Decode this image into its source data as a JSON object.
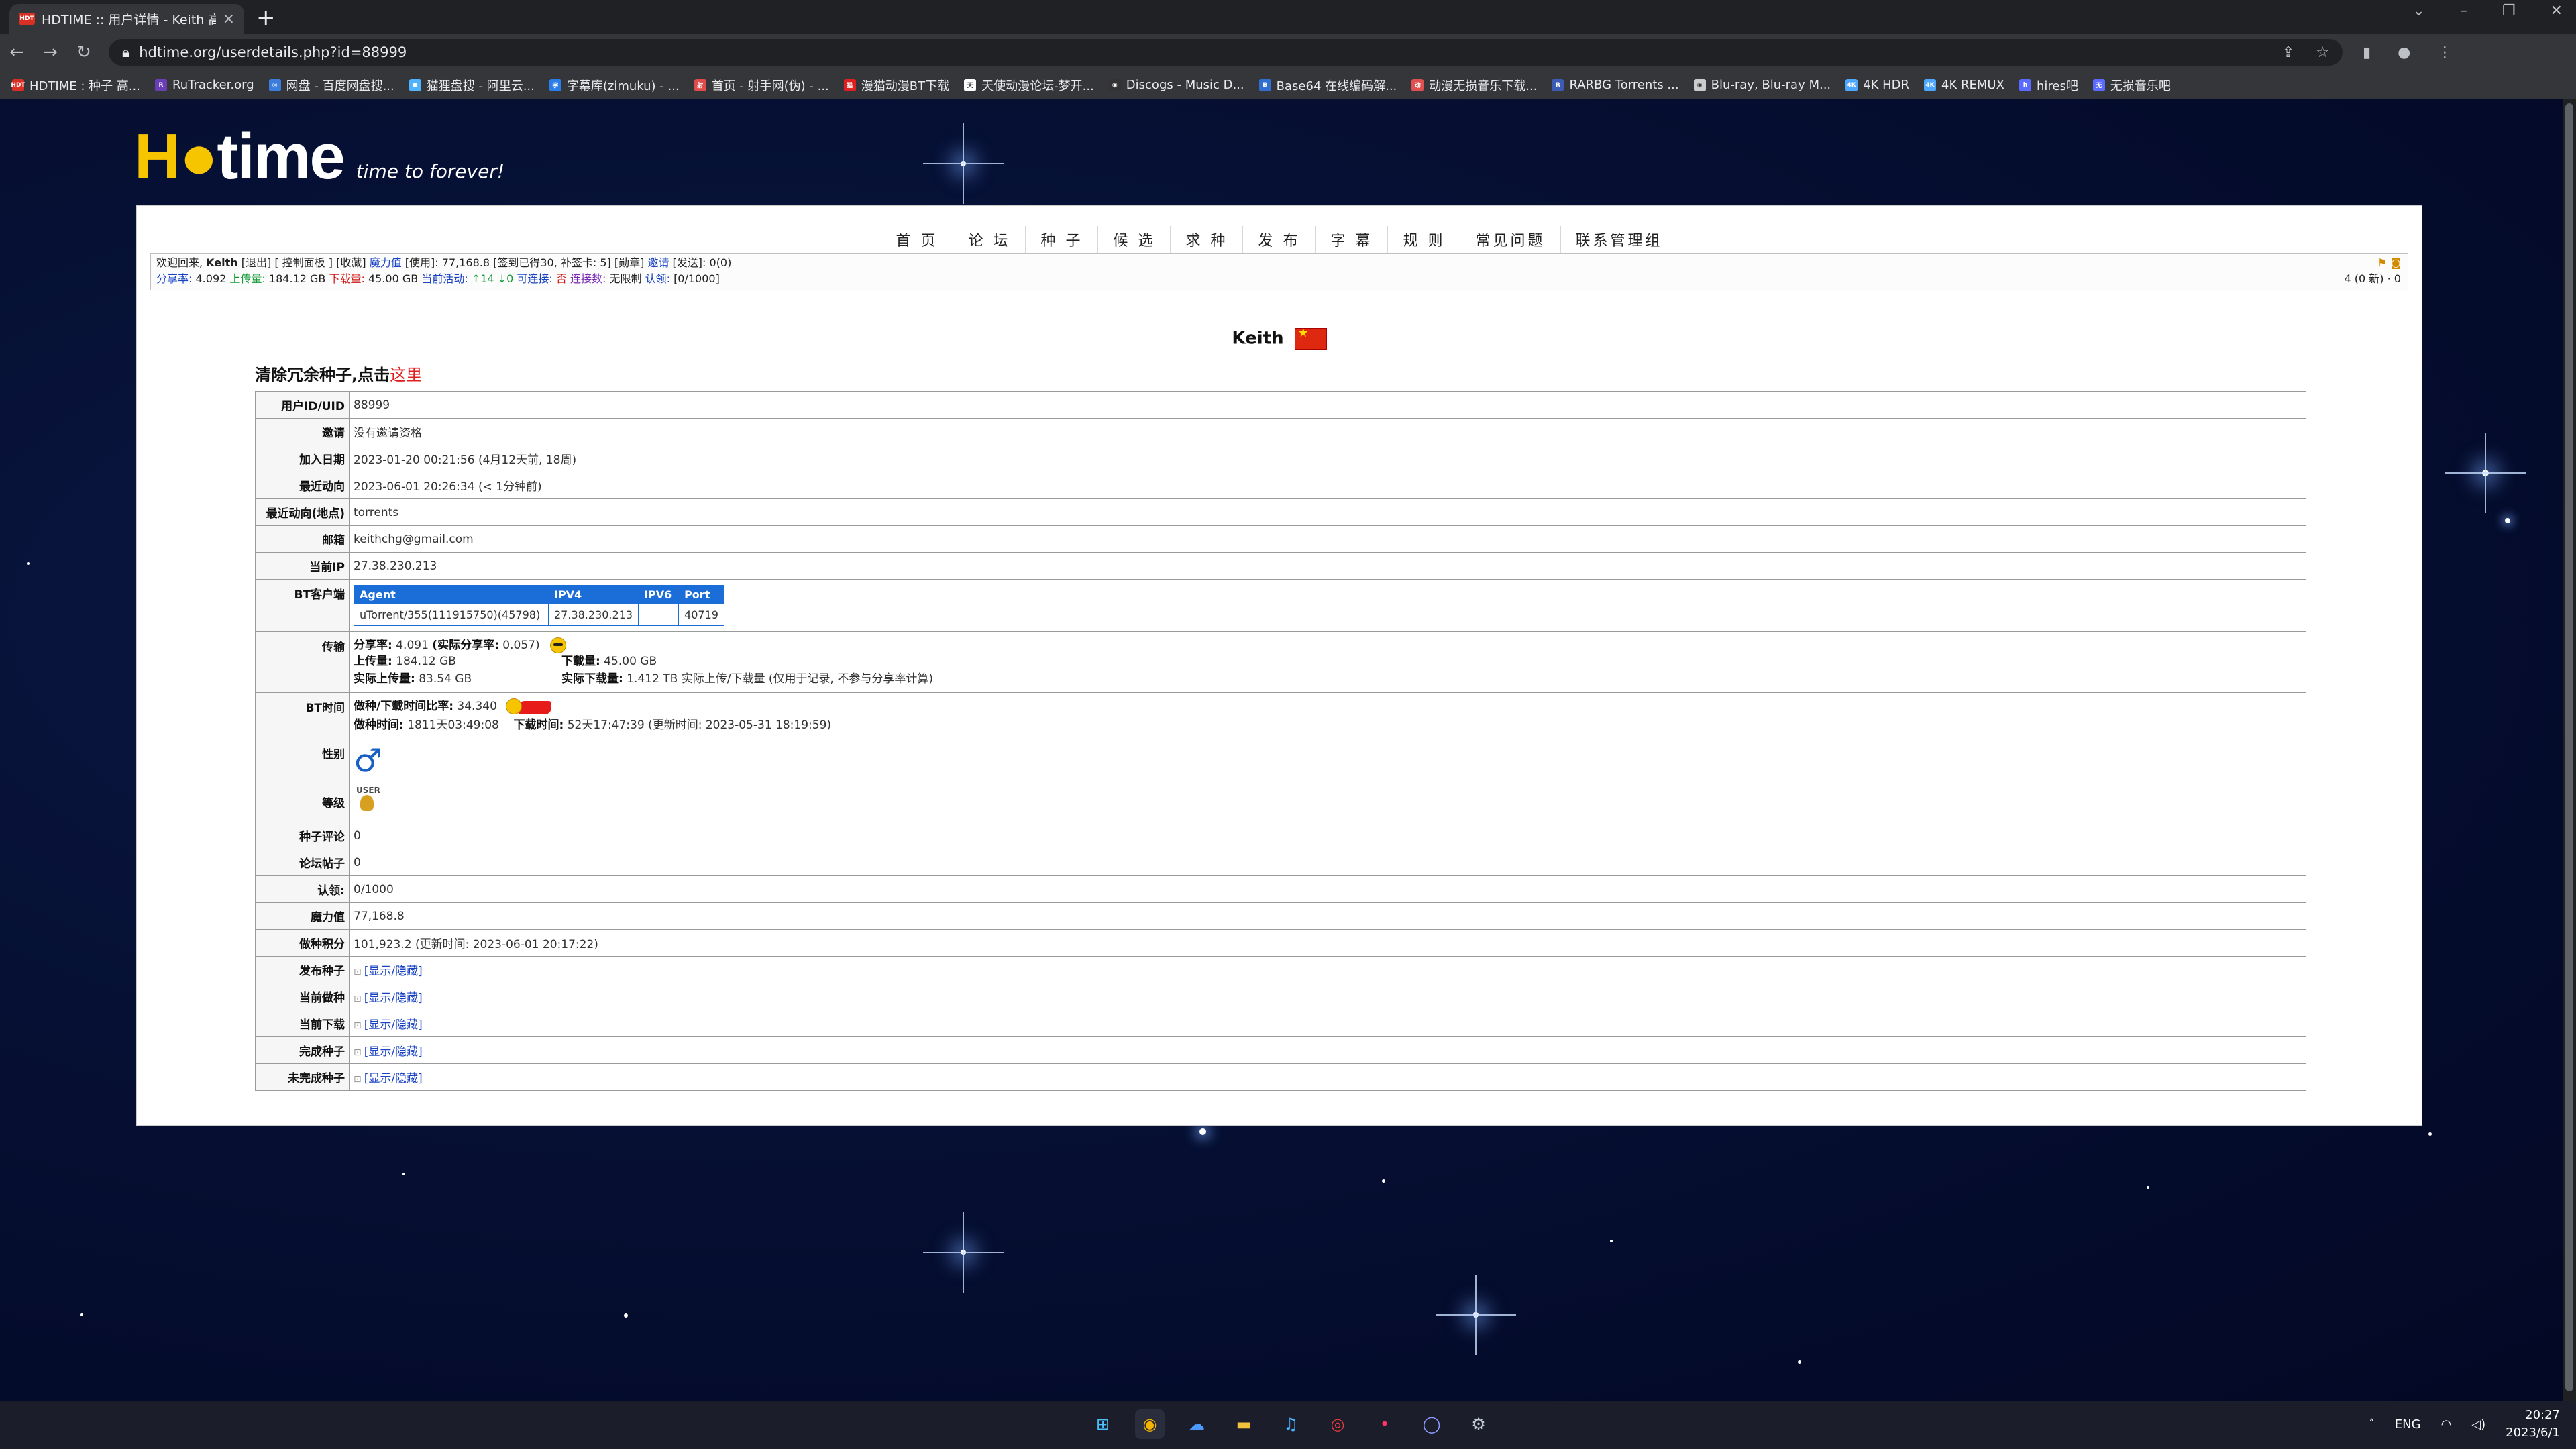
{
  "browser": {
    "tab_title": "HDTIME :: 用户详情 - Keith 高清",
    "tab_favicon": "HDT",
    "url": "hdtime.org/userdetails.php?id=88999",
    "bookmarks": [
      {
        "label": "HDTIME : 种子 高...",
        "icon": "HDT",
        "color": "#d93025"
      },
      {
        "label": "RuTracker.org",
        "icon": "R",
        "color": "#6a3fb5"
      },
      {
        "label": "网盘 - 百度网盘搜...",
        "icon": "◎",
        "color": "#3b7ddd"
      },
      {
        "label": "猫狸盘搜 - 阿里云...",
        "icon": "●",
        "color": "#4fb3ff"
      },
      {
        "label": "字幕库(zimuku) - ...",
        "icon": "字",
        "color": "#2b7de9"
      },
      {
        "label": "首页 - 射手网(伪) - ...",
        "icon": "射",
        "color": "#e14b4b"
      },
      {
        "label": "漫猫动漫BT下载",
        "icon": "猫",
        "color": "#e02020"
      },
      {
        "label": "天使动漫论坛-梦开...",
        "icon": "天",
        "color": "#ffffff"
      },
      {
        "label": "Discogs - Music D...",
        "icon": "◉",
        "color": "#333333"
      },
      {
        "label": "Base64 在线编码解...",
        "icon": "B",
        "color": "#2f6fd1"
      },
      {
        "label": "动漫无损音乐下载...",
        "icon": "动",
        "color": "#e05050"
      },
      {
        "label": "RARBG Torrents ...",
        "icon": "R",
        "color": "#3b5bb5"
      },
      {
        "label": "Blu-ray, Blu-ray M...",
        "icon": "◉",
        "color": "#cccccc"
      },
      {
        "label": "4K HDR",
        "icon": "4K",
        "color": "#4ea7ff"
      },
      {
        "label": "4K REMUX",
        "icon": "4K",
        "color": "#4ea7ff"
      },
      {
        "label": "hires吧",
        "icon": "h",
        "color": "#5b6bff"
      },
      {
        "label": "无损音乐吧",
        "icon": "无",
        "color": "#5b6bff"
      }
    ]
  },
  "site": {
    "logo_text": "H time",
    "tagline": "time to forever!"
  },
  "nav": [
    "首 页",
    "论 坛",
    "种 子",
    "候 选",
    "求 种",
    "发 布",
    "字 幕",
    "规 则",
    "常见问题",
    "联系管理组"
  ],
  "infobar": {
    "line1_welcome": "欢迎回来,",
    "line1_user": "Keith",
    "line1_links": "[退出] [ 控制面板 ] [收藏]",
    "line1_magic_label": "魔力值",
    "line1_magic": "[使用]: 77,168.8 [签到已得30, 补签卡: 5] [勋章]",
    "line1_invite_label": "邀请",
    "line1_invite": "[发送]: 0(0)",
    "line2_ratio_label": "分享率:",
    "line2_ratio": "4.092",
    "line2_up_label": "上传量:",
    "line2_up": "184.12 GB",
    "line2_down_label": "下载量:",
    "line2_down": "45.00 GB",
    "line2_active_label": "当前活动:",
    "line2_active": "↑14 ↓0",
    "line2_conn_label": "可连接:",
    "line2_conn": "否",
    "line2_conncount_label": "连接数:",
    "line2_conncount": "无限制",
    "line2_auth_label": "认领:",
    "line2_auth": "[0/1000]",
    "right": "4 (0 新) · 0"
  },
  "profile": {
    "username": "Keith",
    "clean_text": "清除冗余种子,点击",
    "clean_link": "这里",
    "rows": {
      "uid_label": "用户ID/UID",
      "uid": "88999",
      "invite_label": "邀请",
      "invite": "没有邀请资格",
      "join_label": "加入日期",
      "join": "2023-01-20 00:21:56 (4月12天前, 18周)",
      "last_label": "最近动向",
      "last": "2023-06-01 20:26:34 (< 1分钟前)",
      "last_loc_label": "最近动向(地点)",
      "last_loc": "torrents",
      "email_label": "邮箱",
      "email": "keithchg@gmail.com",
      "ip_label": "当前IP",
      "ip": "27.38.230.213",
      "bt_label": "BT客户端",
      "bt_headers": [
        "Agent",
        "IPV4",
        "IPV6",
        "Port"
      ],
      "bt_row": [
        "uTorrent/355(111915750)(45798)",
        "27.38.230.213",
        "",
        "40719"
      ],
      "transfer_label": "传输",
      "ratio_label": "分享率:",
      "ratio": "4.091",
      "real_ratio_label": "(实际分享率:",
      "real_ratio": "0.057)",
      "up_label": "上传量:",
      "up": "184.12 GB",
      "down_label": "下载量:",
      "down": "45.00 GB",
      "real_up_label": "实际上传量:",
      "real_up": "83.54 GB",
      "real_down_label": "实际下载量:",
      "real_down": "1.412 TB",
      "real_note": "实际上传/下载量 (仅用于记录, 不参与分享率计算)",
      "bttime_label": "BT时间",
      "seed_ratio_label": "做种/下载时间比率:",
      "seed_ratio": "34.340",
      "seed_time_label": "做种时间:",
      "seed_time": "1811天03:49:08",
      "dl_time_label": "下载时间:",
      "dl_time": "52天17:47:39",
      "update_time": "(更新时间: 2023-05-31 18:19:59)",
      "gender_label": "性别",
      "gender_symbol": "♂",
      "level_label": "等级",
      "level_badge": "USER",
      "comments_label": "种子评论",
      "comments": "0",
      "forum_label": "论坛帖子",
      "forum": "0",
      "claim_label": "认领:",
      "claim": "0/1000",
      "magic_label": "魔力值",
      "magic": "77,168.8",
      "seedpoints_label": "做种积分",
      "seedpoints": "101,923.2",
      "seedpoints_update": "(更新时间: 2023-06-01 20:17:22)",
      "toggle_text": "[显示/隐藏]",
      "published_label": "发布种子",
      "seeding_label": "当前做种",
      "leeching_label": "当前下载",
      "completed_label": "完成种子",
      "incomplete_label": "未完成种子"
    }
  },
  "taskbar": {
    "lang": "ENG",
    "time": "20:27",
    "date": "2023/6/1"
  }
}
